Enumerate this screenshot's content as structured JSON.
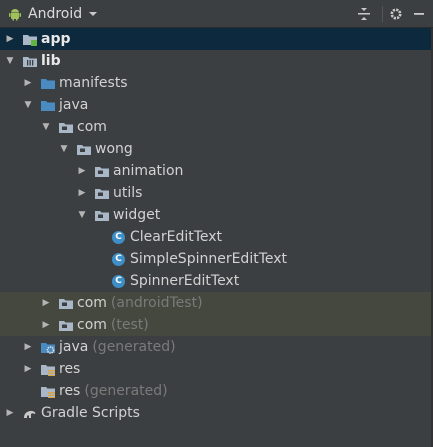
{
  "toolbar": {
    "view_mode": "Android",
    "icons": [
      "android-icon",
      "chevron-down-icon",
      "collapse-all-icon",
      "gear-icon",
      "hide-icon"
    ]
  },
  "tree": [
    {
      "label": "app",
      "hint": "",
      "expanded": false,
      "indent": 0,
      "icon": "module-folder",
      "bold": true,
      "style": "selected"
    },
    {
      "label": "lib",
      "hint": "",
      "expanded": true,
      "indent": 0,
      "icon": "library-folder",
      "bold": true,
      "style": ""
    },
    {
      "label": "manifests",
      "hint": "",
      "expanded": false,
      "indent": 1,
      "icon": "blue-folder",
      "bold": false,
      "style": ""
    },
    {
      "label": "java",
      "hint": "",
      "expanded": true,
      "indent": 1,
      "icon": "blue-folder",
      "bold": false,
      "style": ""
    },
    {
      "label": "com",
      "hint": "",
      "expanded": true,
      "indent": 2,
      "icon": "package-folder",
      "bold": false,
      "style": ""
    },
    {
      "label": "wong",
      "hint": "",
      "expanded": true,
      "indent": 3,
      "icon": "package-folder",
      "bold": false,
      "style": ""
    },
    {
      "label": "animation",
      "hint": "",
      "expanded": false,
      "indent": 4,
      "icon": "package-folder",
      "bold": false,
      "style": ""
    },
    {
      "label": "utils",
      "hint": "",
      "expanded": false,
      "indent": 4,
      "icon": "package-folder",
      "bold": false,
      "style": ""
    },
    {
      "label": "widget",
      "hint": "",
      "expanded": true,
      "indent": 4,
      "icon": "package-folder",
      "bold": false,
      "style": ""
    },
    {
      "label": "ClearEditText",
      "hint": "",
      "expanded": null,
      "indent": 5,
      "icon": "class",
      "bold": false,
      "style": ""
    },
    {
      "label": "SimpleSpinnerEditText",
      "hint": "",
      "expanded": null,
      "indent": 5,
      "icon": "class",
      "bold": false,
      "style": ""
    },
    {
      "label": "SpinnerEditText",
      "hint": "",
      "expanded": null,
      "indent": 5,
      "icon": "class",
      "bold": false,
      "style": ""
    },
    {
      "label": "com",
      "hint": "(androidTest)",
      "expanded": false,
      "indent": 2,
      "icon": "package-folder",
      "bold": false,
      "style": "alt"
    },
    {
      "label": "com",
      "hint": "(test)",
      "expanded": false,
      "indent": 2,
      "icon": "package-folder",
      "bold": false,
      "style": "alt"
    },
    {
      "label": "java",
      "hint": "(generated)",
      "expanded": false,
      "indent": 1,
      "icon": "generated-folder",
      "bold": false,
      "style": ""
    },
    {
      "label": "res",
      "hint": "",
      "expanded": false,
      "indent": 1,
      "icon": "res-folder",
      "bold": false,
      "style": ""
    },
    {
      "label": "res",
      "hint": "(generated)",
      "expanded": null,
      "indent": 1,
      "icon": "res-folder",
      "bold": false,
      "style": ""
    },
    {
      "label": "Gradle Scripts",
      "hint": "",
      "expanded": false,
      "indent": 0,
      "icon": "gradle",
      "bold": false,
      "style": ""
    }
  ],
  "colors": {
    "background": "#3c3f41",
    "selected_row": "#0d293e",
    "test_row": "#44483f",
    "folder_blue": "#4a8cc2",
    "class_blue": "#3d8ec9",
    "package_gray": "#a9b7c6",
    "hint_gray": "#7a7a7a"
  }
}
